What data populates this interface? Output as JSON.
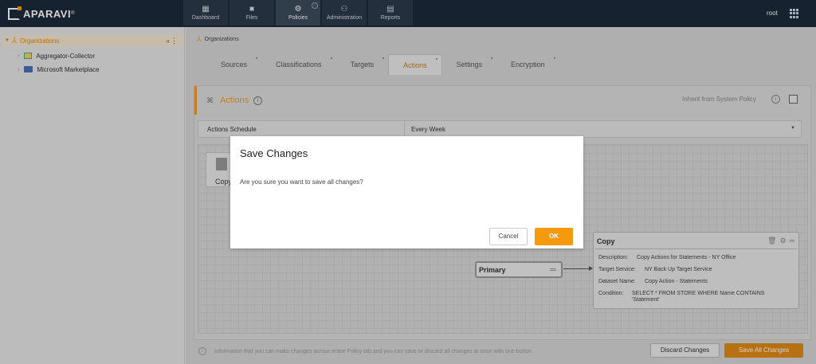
{
  "app": {
    "brand": "APARAVI",
    "user": "root",
    "nav": [
      {
        "label": "Dashboard",
        "icon": "dashboard-icon"
      },
      {
        "label": "Files",
        "icon": "folder-icon"
      },
      {
        "label": "Policies",
        "icon": "gear-icon",
        "active": true
      },
      {
        "label": "Administration",
        "icon": "users-icon"
      },
      {
        "label": "Reports",
        "icon": "report-icon"
      }
    ]
  },
  "sidebar": {
    "root_label": "Organizations",
    "root_controls": "«",
    "children": [
      {
        "label": "Aggregator-Collector",
        "icon": "aggregator-icon"
      },
      {
        "label": "Microsoft Marketplace",
        "icon": "folder-icon"
      }
    ]
  },
  "main": {
    "breadcrumb": "Organizations",
    "tabs": [
      {
        "label": "Sources"
      },
      {
        "label": "Classifications"
      },
      {
        "label": "Targets"
      },
      {
        "label": "Actions",
        "active": true
      },
      {
        "label": "Settings"
      },
      {
        "label": "Encryption"
      }
    ],
    "section_title": "Actions",
    "inherit_label": "Inherit from System Policy",
    "schedule_label": "Actions Schedule",
    "schedule_value": "Every Week",
    "tool_copy_label": "Copy",
    "primary_label": "Primary",
    "copy_node": {
      "title": "Copy",
      "description_label": "Description:",
      "description_value": "Copy Actions for Statements - NY Office",
      "target_label": "Target Service:",
      "target_value": "NY Back Up Target Service",
      "dataset_label": "Dataset Name:",
      "dataset_value": "Copy Action - Statements",
      "condition_label": "Condition:",
      "condition_value": "SELECT * FROM STORE WHERE Name CONTAINS 'Statement'"
    },
    "bottom_info": "Information that you can make changes across entire Policy tab and you can save or discard all changes at once with one button",
    "discard_label": "Discard Changes",
    "save_all_label": "Save All Changes"
  },
  "dialog": {
    "title": "Save Changes",
    "message": "Are you sure you want to save all changes?",
    "cancel_label": "Cancel",
    "ok_label": "OK"
  },
  "colors": {
    "accent": "#f59a23",
    "topbar": "#1c2a3a"
  }
}
